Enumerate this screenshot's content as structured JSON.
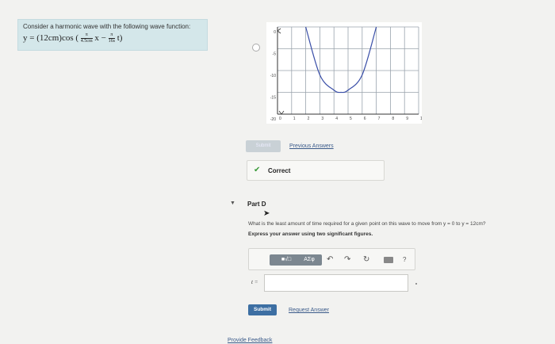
{
  "problem": {
    "intro": "Consider a harmonic wave with the following wave function:",
    "formula_lhs": "y = (12cm)cos (",
    "frac1_num": "π",
    "frac1_den": "4.5cm",
    "var_x": "x −",
    "frac2_num": "π",
    "frac2_den": "16s",
    "var_t": "t)"
  },
  "chart_data": {
    "type": "line",
    "x_ticks": [
      "0",
      "1",
      "2",
      "3",
      "4",
      "5",
      "6",
      "7",
      "8",
      "9",
      "10"
    ],
    "y_ticks": [
      "0",
      "-5",
      "-10",
      "-15",
      "-20"
    ],
    "xlim": [
      0,
      10
    ],
    "ylim": [
      -20,
      0
    ],
    "grid": true,
    "series": [
      {
        "x": [
          2.0,
          3.0,
          4.0,
          4.5,
          5.0,
          6.0,
          7.0
        ],
        "y": [
          0,
          -11.0,
          -14.5,
          -15.0,
          -14.5,
          -11.0,
          0
        ]
      }
    ]
  },
  "actions": {
    "submit_disabled_label": "Submit",
    "previous_answers_label": "Previous Answers"
  },
  "feedback": {
    "status_label": "Correct"
  },
  "part_d": {
    "title": "Part D",
    "question": "What is the least amount of time required for a given point on this wave to move from y = 0 to y = 12cm?",
    "instruction": "Express your answer using two significant figures.",
    "toolbar": {
      "templates_label": "■√□",
      "symbols_label": "ΑΣφ",
      "undo_icon": "↶",
      "redo_icon": "↷",
      "reset_icon": "↻",
      "help_icon": "?"
    },
    "answer_variable": "t =",
    "answer_value": "",
    "submit_label": "Submit",
    "request_answer_label": "Request Answer"
  },
  "footer": {
    "provide_feedback_label": "Provide Feedback"
  }
}
